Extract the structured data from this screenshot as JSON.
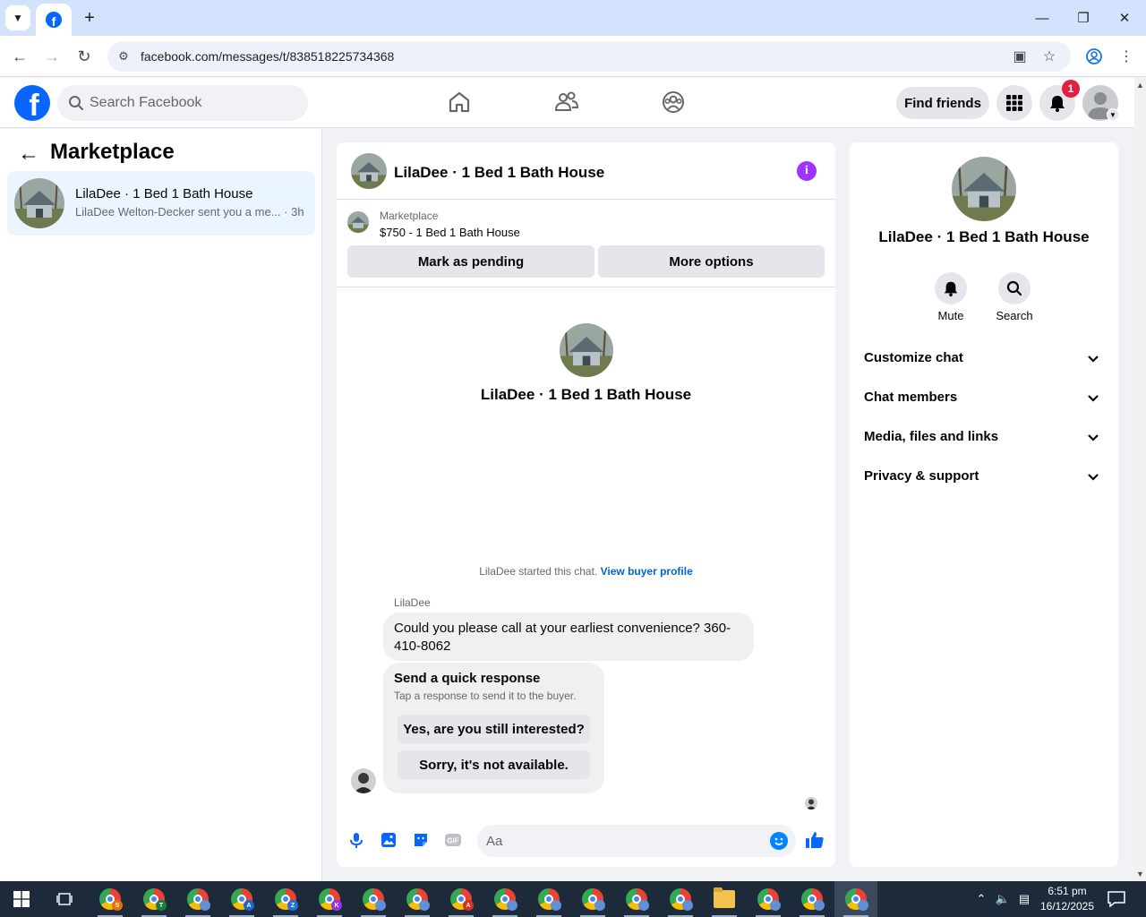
{
  "browser": {
    "url": "facebook.com/messages/t/838518225734368"
  },
  "fb_header": {
    "search_placeholder": "Search Facebook",
    "find_friends_label": "Find friends",
    "notification_count": "1"
  },
  "left_panel": {
    "title": "Marketplace",
    "conversations": [
      {
        "name": "LilaDee · 1 Bed 1 Bath House",
        "preview": "LilaDee Welton-Decker sent you a me...",
        "time": "· 3h"
      }
    ]
  },
  "chat": {
    "title": "LilaDee · 1 Bed 1 Bath House",
    "listing_label": "Marketplace",
    "listing_price_title": "$750 - 1 Bed 1 Bath House",
    "mark_pending_label": "Mark as pending",
    "more_options_label": "More options",
    "intro_name": "LilaDee · 1 Bed 1 Bath House",
    "started_text": "LilaDee started this chat.",
    "view_buyer_profile": "View buyer profile",
    "sender_name": "LilaDee",
    "message_text": "Could you please call at your earliest convenience? 360-410-8062",
    "quick_response_title": "Send a quick response",
    "quick_response_subtitle": "Tap a response to send it to the buyer.",
    "quick_responses": [
      "Yes, are you still interested?",
      "Sorry, it's not available."
    ],
    "composer_placeholder": "Aa"
  },
  "right_panel": {
    "name": "LilaDee · 1 Bed 1 Bath House",
    "mute_label": "Mute",
    "search_label": "Search",
    "sections": [
      "Customize chat",
      "Chat members",
      "Media, files and links",
      "Privacy & support"
    ]
  },
  "taskbar": {
    "time": "6:51 pm",
    "date": "16/12/2025",
    "profile_letters": [
      "S",
      "T",
      "",
      "A",
      "Z",
      "K",
      "",
      "",
      "A",
      "",
      "",
      "",
      "",
      "",
      "",
      "",
      "",
      ""
    ]
  },
  "colors": {
    "fb_blue": "#0866ff",
    "link_blue": "#0064d1",
    "info_purple": "#a033ff",
    "badge_red": "#e41e3f",
    "selected_conv_bg": "#ebf5ff"
  }
}
